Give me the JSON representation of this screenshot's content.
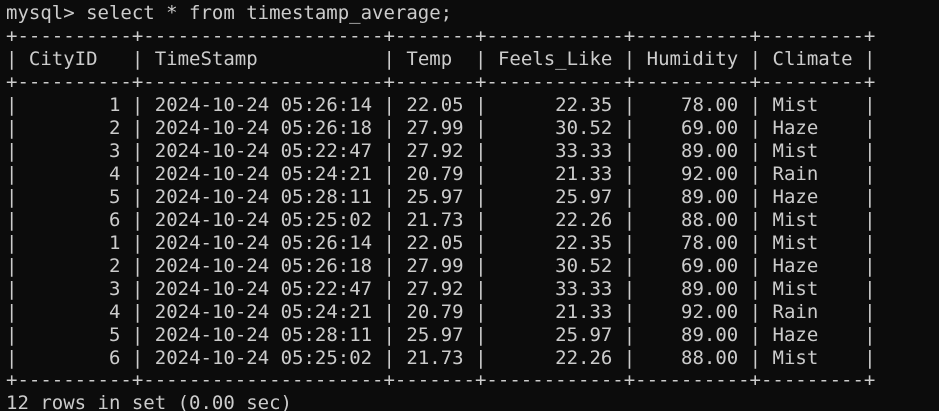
{
  "prompt": "mysql> ",
  "command": "select * from timestamp_average;",
  "table": {
    "border": "+----------+---------------------+-------+------------+----------+---------+",
    "columns": [
      {
        "key": "cityid",
        "label": "CityID",
        "width": 8,
        "align": "left"
      },
      {
        "key": "timestamp",
        "label": "TimeStamp",
        "width": 19,
        "align": "left"
      },
      {
        "key": "temp",
        "label": "Temp",
        "width": 5,
        "align": "left"
      },
      {
        "key": "feels_like",
        "label": "Feels_Like",
        "width": 10,
        "align": "left"
      },
      {
        "key": "humidity",
        "label": "Humidity",
        "width": 8,
        "align": "left"
      },
      {
        "key": "climate",
        "label": "Climate",
        "width": 7,
        "align": "left"
      }
    ],
    "cell_align": [
      "right",
      "left",
      "right",
      "right",
      "right",
      "left"
    ],
    "rows": [
      [
        "1",
        "2024-10-24 05:26:14",
        "22.05",
        "22.35",
        "78.00",
        "Mist"
      ],
      [
        "2",
        "2024-10-24 05:26:18",
        "27.99",
        "30.52",
        "69.00",
        "Haze"
      ],
      [
        "3",
        "2024-10-24 05:22:47",
        "27.92",
        "33.33",
        "89.00",
        "Mist"
      ],
      [
        "4",
        "2024-10-24 05:24:21",
        "20.79",
        "21.33",
        "92.00",
        "Rain"
      ],
      [
        "5",
        "2024-10-24 05:28:11",
        "25.97",
        "25.97",
        "89.00",
        "Haze"
      ],
      [
        "6",
        "2024-10-24 05:25:02",
        "21.73",
        "22.26",
        "88.00",
        "Mist"
      ],
      [
        "1",
        "2024-10-24 05:26:14",
        "22.05",
        "22.35",
        "78.00",
        "Mist"
      ],
      [
        "2",
        "2024-10-24 05:26:18",
        "27.99",
        "30.52",
        "69.00",
        "Haze"
      ],
      [
        "3",
        "2024-10-24 05:22:47",
        "27.92",
        "33.33",
        "89.00",
        "Mist"
      ],
      [
        "4",
        "2024-10-24 05:24:21",
        "20.79",
        "21.33",
        "92.00",
        "Rain"
      ],
      [
        "5",
        "2024-10-24 05:28:11",
        "25.97",
        "25.97",
        "89.00",
        "Haze"
      ],
      [
        "6",
        "2024-10-24 05:25:02",
        "21.73",
        "22.26",
        "88.00",
        "Mist"
      ]
    ]
  },
  "result_summary": "12 rows in set (0.00 sec)",
  "colors": {
    "background": "#0c0c0c",
    "text": "#cccccc"
  }
}
